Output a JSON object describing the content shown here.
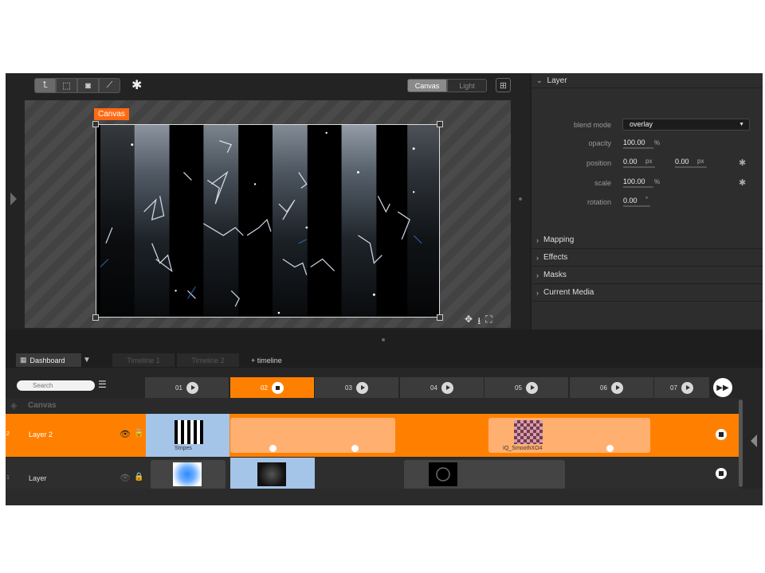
{
  "preview": {
    "toolbar_icons": [
      "transform-icon",
      "crop-icon",
      "mask-icon",
      "brush-icon"
    ],
    "toolbar_glyphs": [
      "⮤",
      "⬚",
      "◙",
      "⟋"
    ],
    "settings_glyph": "✱",
    "mode_active": "Canvas",
    "mode_inactive": "Light",
    "grid_glyph": "⊞",
    "canvas_tag": "Canvas",
    "view_glyphs": [
      "✥",
      "⭳",
      "⛶"
    ]
  },
  "panel": {
    "layer_title": "Layer",
    "props": {
      "blend_mode_label": "blend mode",
      "blend_mode_value": "overlay",
      "opacity_label": "opacity",
      "opacity_value": "100.00",
      "opacity_unit": "%",
      "position_label": "position",
      "position_x": "0.00",
      "position_y": "0.00",
      "px_unit": "px",
      "scale_label": "scale",
      "scale_value": "100.00",
      "scale_unit": "%",
      "rotation_label": "rotation",
      "rotation_value": "0.00",
      "rotation_unit": "°"
    },
    "sections": [
      "Mapping",
      "Effects",
      "Masks",
      "Current Media"
    ]
  },
  "tabs": {
    "dashboard": "Dashboard",
    "menu_glyph": "▼",
    "timeline1": "Timeline 1",
    "timeline2": "Timeline 2",
    "add": "+ timeline"
  },
  "timeline": {
    "search_placeholder": "Search",
    "columns": [
      "01",
      "02",
      "03",
      "04",
      "05",
      "06",
      "07"
    ],
    "active_column": "02",
    "canvas_row_label": "Canvas",
    "rows": [
      {
        "num": "2",
        "name": "Layer 2"
      },
      {
        "num": "1",
        "name": "Layer"
      }
    ],
    "clips": {
      "stripes": "Stripes",
      "iq": "IQ_SmoothXO4"
    }
  },
  "colors": {
    "accent": "#ff8000",
    "tag": "#ff6a13",
    "clip_selected": "#a4c4e8"
  }
}
